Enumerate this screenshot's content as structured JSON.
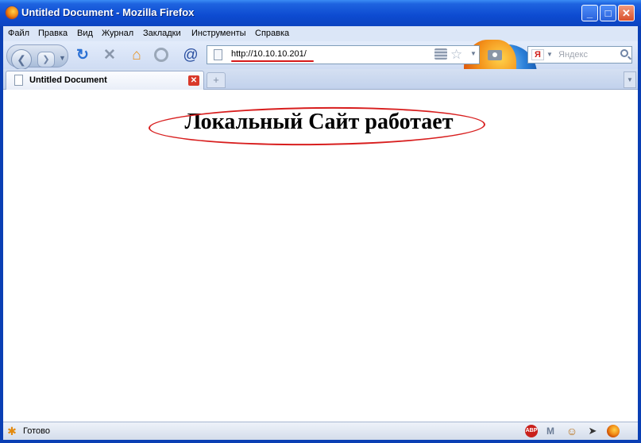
{
  "window": {
    "title": "Untitled Document - Mozilla Firefox"
  },
  "menu": [
    "Файл",
    "Правка",
    "Вид",
    "Журнал",
    "Закладки",
    "Инструменты",
    "Справка"
  ],
  "navbar": {
    "url": "http://10.10.10.201/",
    "search_placeholder": "Яндекс",
    "search_engine_letter": "Я"
  },
  "tabs": [
    {
      "label": "Untitled Document",
      "active": true
    }
  ],
  "page": {
    "heading": "Локальный Сайт работает"
  },
  "status": {
    "text": "Готово"
  },
  "colors": {
    "titlebar": "#0d4bd1",
    "annotation": "#d81e1e",
    "url_underline": "#d61a1a"
  },
  "icons": [
    "firefox-icon",
    "back-icon",
    "forward-icon",
    "reload-icon",
    "stop-icon",
    "home-icon",
    "addon-icon",
    "page-icon",
    "rss-icon",
    "bookmark-star-icon",
    "camera-icon",
    "search-icon",
    "adblock-icon",
    "gmail-icon",
    "smiley-icon",
    "cursor-icon"
  ]
}
